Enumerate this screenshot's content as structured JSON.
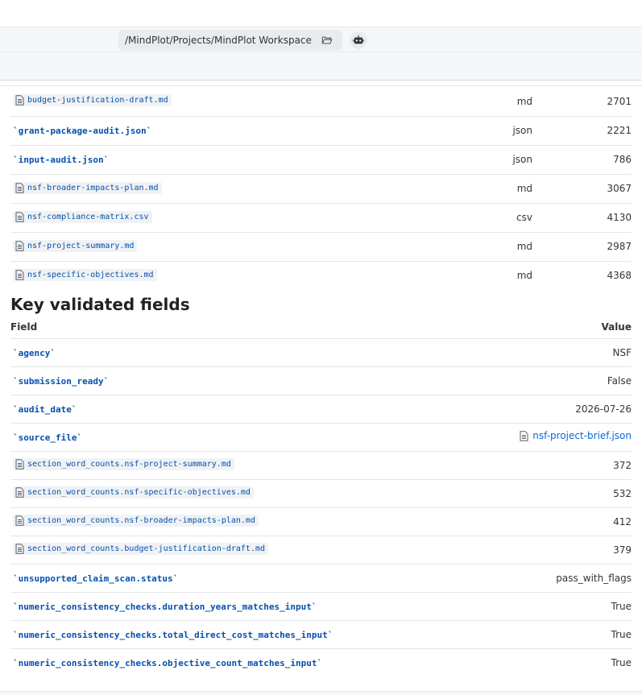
{
  "toolbar": {
    "path": "/MindPlot/Projects/MindPlot Workspace",
    "folder_icon": "folder-open-icon",
    "bot_icon": "robot-icon"
  },
  "files": [
    {
      "name": "budget-justification-draft.md",
      "style": "file",
      "ext": "md",
      "size": "2701"
    },
    {
      "name": "`grant-package-audit.json`",
      "style": "code",
      "ext": "json",
      "size": "2221"
    },
    {
      "name": "`input-audit.json`",
      "style": "code",
      "ext": "json",
      "size": "786"
    },
    {
      "name": "nsf-broader-impacts-plan.md",
      "style": "file",
      "ext": "md",
      "size": "3067"
    },
    {
      "name": "nsf-compliance-matrix.csv",
      "style": "file",
      "ext": "csv",
      "size": "4130"
    },
    {
      "name": "nsf-project-summary.md",
      "style": "file",
      "ext": "md",
      "size": "2987"
    },
    {
      "name": "nsf-specific-objectives.md",
      "style": "file",
      "ext": "md",
      "size": "4368"
    }
  ],
  "validated": {
    "heading": "Key validated fields",
    "col_field": "Field",
    "col_value": "Value",
    "rows": [
      {
        "field": "`agency`",
        "style": "code",
        "value": "NSF"
      },
      {
        "field": "`submission_ready`",
        "style": "code",
        "value": "False"
      },
      {
        "field": "`audit_date`",
        "style": "code",
        "value": "2026-07-26"
      },
      {
        "field": "`source_file`",
        "style": "code",
        "value": "nsf-project-brief.json",
        "value_style": "link"
      },
      {
        "field": "section_word_counts.nsf-project-summary.md",
        "style": "file",
        "value": "372"
      },
      {
        "field": "section_word_counts.nsf-specific-objectives.md",
        "style": "file",
        "value": "532"
      },
      {
        "field": "section_word_counts.nsf-broader-impacts-plan.md",
        "style": "file",
        "value": "412"
      },
      {
        "field": "section_word_counts.budget-justification-draft.md",
        "style": "file",
        "value": "379"
      },
      {
        "field": "`unsupported_claim_scan.status`",
        "style": "code",
        "value": "pass_with_flags"
      },
      {
        "field": "`numeric_consistency_checks.duration_years_matches_input`",
        "style": "code",
        "value": "True"
      },
      {
        "field": "`numeric_consistency_checks.total_direct_cost_matches_input`",
        "style": "code",
        "value": "True"
      },
      {
        "field": "`numeric_consistency_checks.objective_count_matches_input`",
        "style": "code",
        "value": "True"
      }
    ]
  },
  "colors": {
    "code_text": "#0550ae",
    "link": "#0969da"
  }
}
